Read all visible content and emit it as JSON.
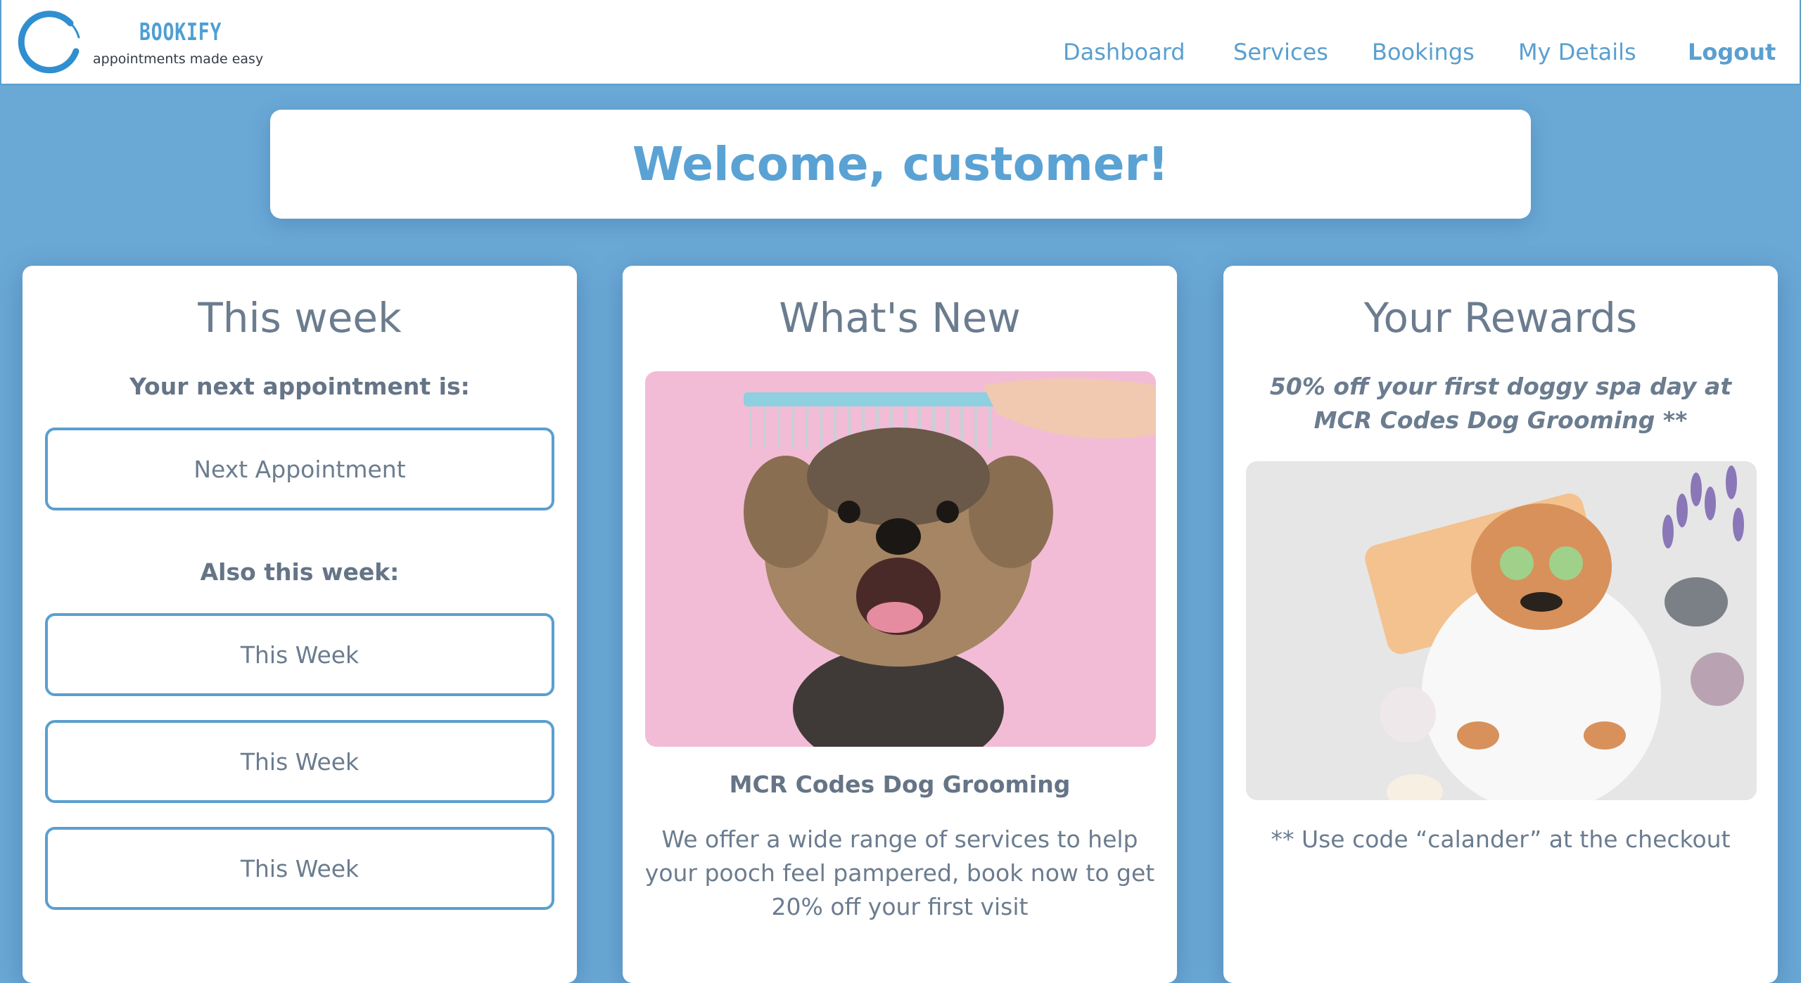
{
  "brand": {
    "name": "BOOKIFY",
    "tagline": "appointments made easy",
    "color": "#4f9fd3"
  },
  "nav": {
    "dashboard": "Dashboard",
    "services": "Services",
    "bookings": "Bookings",
    "my_details": "My Details",
    "logout": "Logout"
  },
  "welcome": "Welcome, customer!",
  "this_week": {
    "title": "This week",
    "next_label": "Your next appointment is:",
    "next_button": "Next Appointment",
    "also_label": "Also this week:",
    "items": [
      "This Week",
      "This Week",
      "This Week"
    ]
  },
  "whats_new": {
    "title": "What's New",
    "image_icon": "dog-grooming-photo",
    "heading": "MCR Codes Dog Grooming",
    "body": "We offer a wide range of services to help your pooch feel pampered, book now to get 20% off your first visit"
  },
  "rewards": {
    "title": "Your Rewards",
    "offer": "50% off your first doggy spa day at MCR Codes Dog Grooming **",
    "image_icon": "dog-spa-photo",
    "note": "** Use code “calander” at the checkout"
  },
  "colors": {
    "background": "#6aa8d6",
    "accent": "#5a9fd0",
    "text": "#6b7c8f"
  }
}
